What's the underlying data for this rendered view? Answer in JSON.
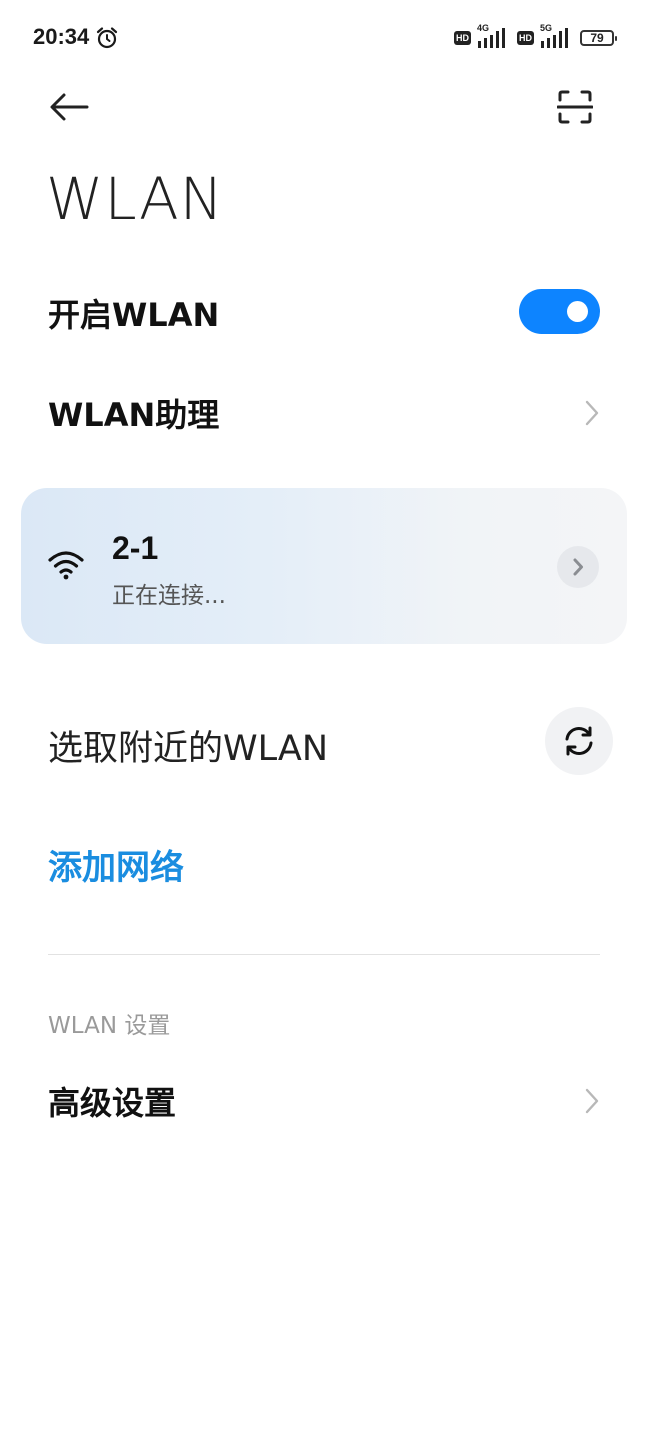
{
  "status_bar": {
    "time": "20:34",
    "alarm_icon": "alarm-clock-icon",
    "hd_badge_1": "HD",
    "net_1": "4G",
    "hd_badge_2": "HD",
    "net_2": "5G",
    "battery": "79"
  },
  "header": {
    "back_icon": "arrow-left-icon",
    "scan_icon": "scan-icon"
  },
  "page": {
    "title": "WLAN"
  },
  "wlan_toggle": {
    "label": "开启WLAN",
    "on": true,
    "color": "#0d84ff"
  },
  "wlan_assistant": {
    "label": "WLAN助理"
  },
  "connected_network": {
    "name": "2-1",
    "status": "正在连接..."
  },
  "nearby": {
    "label": "选取附近的WLAN"
  },
  "add_network": {
    "label": "添加网络",
    "color": "#1a8de0"
  },
  "settings_section": {
    "header": "WLAN 设置",
    "advanced_label": "高级设置"
  }
}
